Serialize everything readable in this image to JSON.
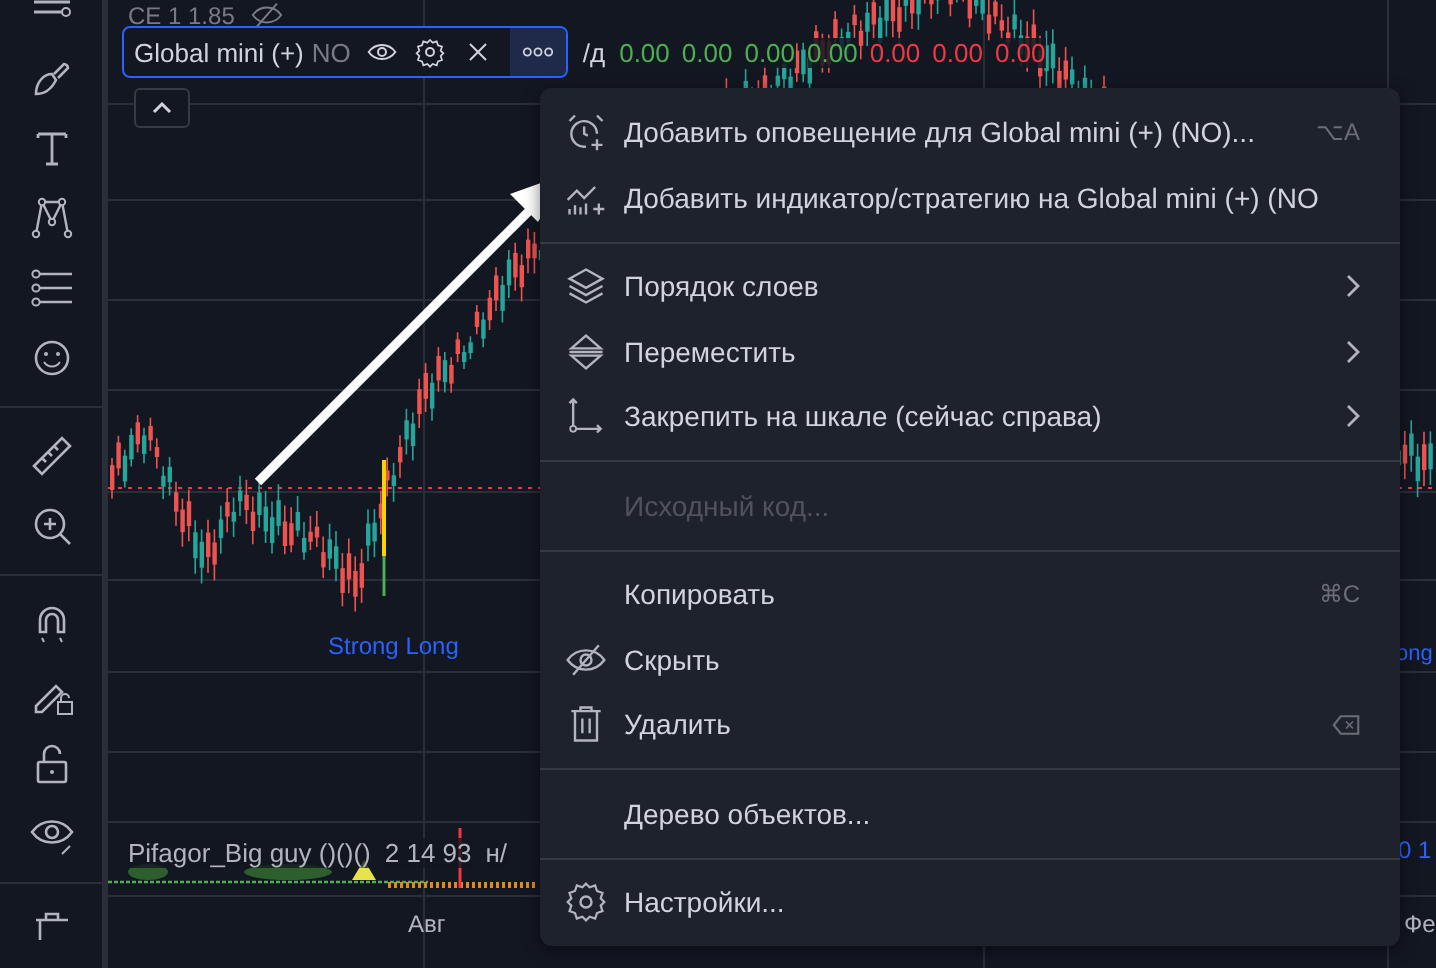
{
  "top_legend": {
    "text": "CE 1 1.85"
  },
  "legend": {
    "title": "Global mini (+)",
    "status": "NO",
    "more_selected": true,
    "prefix": "/д",
    "values": [
      {
        "text": "0.00",
        "color": "#4caf50"
      },
      {
        "text": "0.00",
        "color": "#4caf50"
      },
      {
        "text": "0.00",
        "color": "#4caf50"
      },
      {
        "text": "0.00",
        "color": "#4caf50"
      },
      {
        "text": "0.00",
        "color": "#f23645"
      },
      {
        "text": "0.00",
        "color": "#f23645"
      },
      {
        "text": "0.00",
        "color": "#f23645"
      }
    ]
  },
  "chart_labels": {
    "signal": "Strong Long",
    "signal_right": "ong",
    "right_values": "0 1"
  },
  "indicator": {
    "title": "Pifagor_Big guy ()()()",
    "values": "2 14 93",
    "suffix": "н/"
  },
  "time_axis": [
    {
      "label": "Авг"
    },
    {
      "label": "Фе"
    }
  ],
  "menu": {
    "items": [
      {
        "kind": "alert",
        "label": "Добавить оповещение для Global mini (+) (NO)...",
        "shortcut": "⌥A",
        "submenu": false,
        "disabled": false
      },
      {
        "kind": "indicator",
        "label": "Добавить индикатор/стратегию на Global mini (+) (NO",
        "submenu": false,
        "disabled": false
      },
      {
        "kind": "separator"
      },
      {
        "kind": "layers",
        "label": "Порядок слоев",
        "submenu": true,
        "disabled": false
      },
      {
        "kind": "move",
        "label": "Переместить",
        "submenu": true,
        "disabled": false
      },
      {
        "kind": "pin",
        "label": "Закрепить на шкале (сейчас справа)",
        "submenu": true,
        "disabled": false
      },
      {
        "kind": "separator"
      },
      {
        "kind": "plain",
        "label": "Исходный код...",
        "submenu": false,
        "disabled": true
      },
      {
        "kind": "separator"
      },
      {
        "kind": "plain",
        "label": "Копировать",
        "shortcut": "⌘C",
        "submenu": false,
        "disabled": false
      },
      {
        "kind": "hide",
        "label": "Скрыть",
        "submenu": false,
        "disabled": false
      },
      {
        "kind": "delete",
        "label": "Удалить",
        "submenu": false,
        "disabled": false
      },
      {
        "kind": "separator"
      },
      {
        "kind": "plain",
        "label": "Дерево объектов...",
        "submenu": false,
        "disabled": false
      },
      {
        "kind": "separator"
      },
      {
        "kind": "settings",
        "label": "Настройки...",
        "submenu": false,
        "disabled": false
      }
    ]
  }
}
